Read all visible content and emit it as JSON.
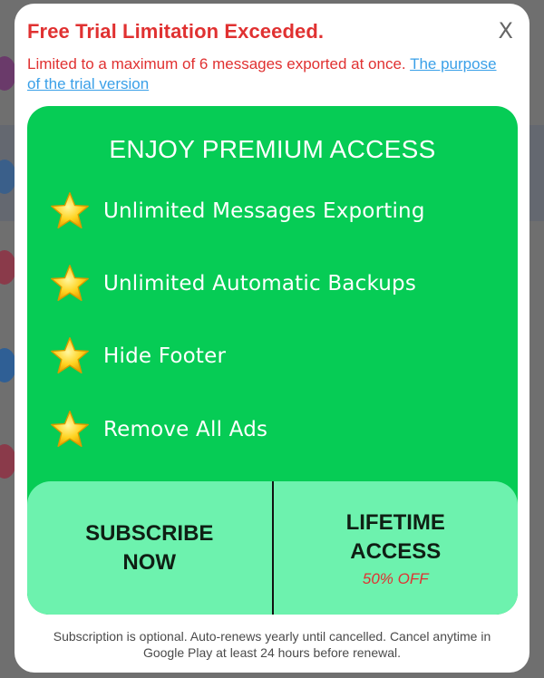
{
  "dialog": {
    "title": "Free Trial Limitation Exceeded.",
    "close_label": "X",
    "limit_message": "Limited to a maximum of 6 messages exported at once.",
    "limit_link": "The purpose of the trial version"
  },
  "premium": {
    "heading": "ENJOY PREMIUM ACCESS",
    "features": [
      {
        "label": "Unlimited Messages Exporting",
        "icon": "star-icon"
      },
      {
        "label": "Unlimited Automatic Backups",
        "icon": "star-icon"
      },
      {
        "label": "Hide Footer",
        "icon": "star-icon"
      },
      {
        "label": "Remove All Ads",
        "icon": "star-icon"
      }
    ]
  },
  "actions": {
    "subscribe_label": "SUBSCRIBE NOW",
    "lifetime_label": "LIFETIME ACCESS",
    "lifetime_discount": "50% OFF"
  },
  "footer": {
    "note": "Subscription is optional. Auto-renews yearly until cancelled. Cancel anytime in Google Play at least 24 hours before renewal."
  },
  "colors": {
    "title_red": "#e03131",
    "card_green": "#06cc55",
    "button_mint": "#6df2ae",
    "link_blue": "#3aa0e8"
  }
}
